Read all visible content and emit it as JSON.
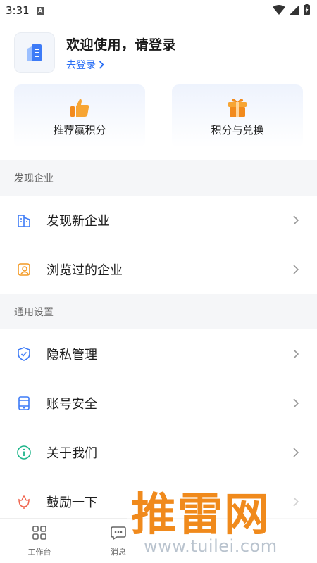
{
  "status_bar": {
    "time": "3:31",
    "app_icon_letter": "A"
  },
  "profile": {
    "welcome": "欢迎使用，请登录",
    "login_link": "去登录"
  },
  "cards": [
    {
      "label": "推荐赢积分",
      "icon": "thumbs-up-icon"
    },
    {
      "label": "积分与兑换",
      "icon": "gift-icon"
    }
  ],
  "sections": [
    {
      "title": "发现企业",
      "items": [
        {
          "label": "发现新企业",
          "icon": "building-icon"
        },
        {
          "label": "浏览过的企业",
          "icon": "history-icon"
        }
      ]
    },
    {
      "title": "通用设置",
      "items": [
        {
          "label": "隐私管理",
          "icon": "shield-icon"
        },
        {
          "label": "账号安全",
          "icon": "phone-icon"
        },
        {
          "label": "关于我们",
          "icon": "info-icon"
        },
        {
          "label": "鼓励一下",
          "icon": "flower-icon"
        }
      ]
    }
  ],
  "bottom_nav": [
    {
      "label": "工作台",
      "icon": "grid-icon"
    },
    {
      "label": "消息",
      "icon": "message-icon"
    }
  ],
  "watermark": {
    "title": "推雷网",
    "url": "www.tuilei.com"
  },
  "colors": {
    "accent": "#2a6ff5",
    "orange": "#f39a25",
    "teal": "#1fb58a",
    "section_bg": "#f5f6f8"
  }
}
